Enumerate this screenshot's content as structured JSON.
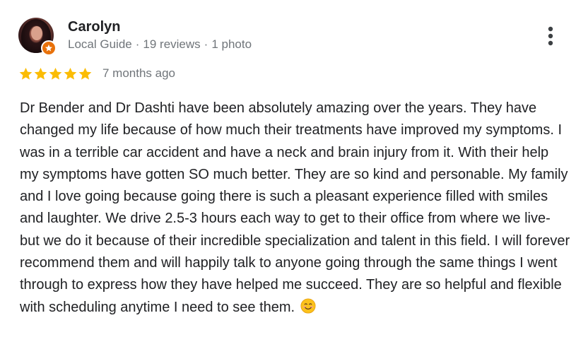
{
  "reviewer": {
    "name": "Carolyn",
    "badge": "Local Guide",
    "reviews_count": "19 reviews",
    "photos_count": "1 photo",
    "separator": "·",
    "badge_color": "#e8710a"
  },
  "review": {
    "rating": 5,
    "rating_max": 5,
    "date": "7 months ago",
    "text": "Dr Bender and Dr Dashti have been absolutely amazing over the years. They have changed my life because of how much their treatments have improved my symptoms. I was in a terrible car accident and have a neck and brain injury from it. With their help my symptoms have gotten SO much better. They are so kind and personable. My family and I love going because going there is such a pleasant experience filled with smiles and laughter. We drive 2.5-3 hours each way to get to their office from where we live- but we do it because of their incredible specialization and talent in this field. I will forever recommend them and will happily talk to anyone going through the same things I went through to express how they have helped me succeed. They are so helpful and flexible with scheduling anytime I need to see them.",
    "emoji": "smiling-face-icon"
  },
  "icons": {
    "more": "more-vert-icon",
    "star": "star-icon",
    "local_guide": "local-guide-star-icon"
  },
  "colors": {
    "star": "#fbbc04",
    "text": "#202124",
    "meta": "#70757a"
  }
}
